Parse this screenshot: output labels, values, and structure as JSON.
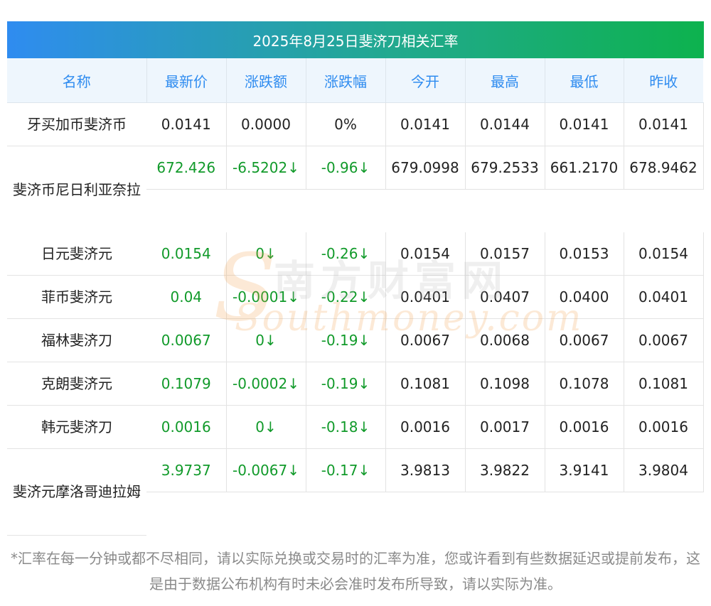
{
  "title": "2025年8月25日斐济刀相关汇率",
  "headers": [
    "名称",
    "最新价",
    "涨跌额",
    "涨跌幅",
    "今开",
    "最高",
    "最低",
    "昨收"
  ],
  "rows": [
    {
      "name": "牙买加币斐济币",
      "latest": "0.0141",
      "change": "0.0000",
      "pct": "0%",
      "open": "0.0141",
      "high": "0.0144",
      "low": "0.0141",
      "prev": "0.0141"
    },
    {
      "name": "斐济币尼日利亚奈拉",
      "latest": "672.426",
      "change": "-6.5202↓",
      "pct": "-0.96↓",
      "open": "679.0998",
      "high": "679.2533",
      "low": "661.2170",
      "prev": "678.9462"
    },
    {
      "name": "日元斐济元",
      "latest": "0.0154",
      "change": "0↓",
      "pct": "-0.26↓",
      "open": "0.0154",
      "high": "0.0157",
      "low": "0.0153",
      "prev": "0.0154"
    },
    {
      "name": "菲币斐济元",
      "latest": "0.04",
      "change": "-0.0001↓",
      "pct": "-0.22↓",
      "open": "0.0401",
      "high": "0.0407",
      "low": "0.0400",
      "prev": "0.0401"
    },
    {
      "name": "福林斐济刀",
      "latest": "0.0067",
      "change": "0↓",
      "pct": "-0.19↓",
      "open": "0.0067",
      "high": "0.0068",
      "low": "0.0067",
      "prev": "0.0067"
    },
    {
      "name": "克朗斐济元",
      "latest": "0.1079",
      "change": "-0.0002↓",
      "pct": "-0.19↓",
      "open": "0.1081",
      "high": "0.1098",
      "low": "0.1078",
      "prev": "0.1081"
    },
    {
      "name": "韩元斐济刀",
      "latest": "0.0016",
      "change": "0↓",
      "pct": "-0.18↓",
      "open": "0.0016",
      "high": "0.0017",
      "low": "0.0016",
      "prev": "0.0016"
    },
    {
      "name": "斐济元摩洛哥迪拉姆",
      "latest": "3.9737",
      "change": "-0.0067↓",
      "pct": "-0.17↓",
      "open": "3.9813",
      "high": "3.9822",
      "low": "3.9141",
      "prev": "3.9804"
    }
  ],
  "watermark": {
    "cn": "南方财富网",
    "en": "Southmoney.com"
  },
  "footnote": "*汇率在每一分钟或都不尽相同，请以实际兑换或交易时的汇率为准，您或许看到有些数据延迟或提前发布，这是由于数据公布机构有时未必会准时发布所导致，请以实际为准。",
  "colors": {
    "header_text": "#2f8cf0",
    "down": "#119a2a",
    "banner_start": "#2f8cf0",
    "banner_end": "#0db24e"
  }
}
